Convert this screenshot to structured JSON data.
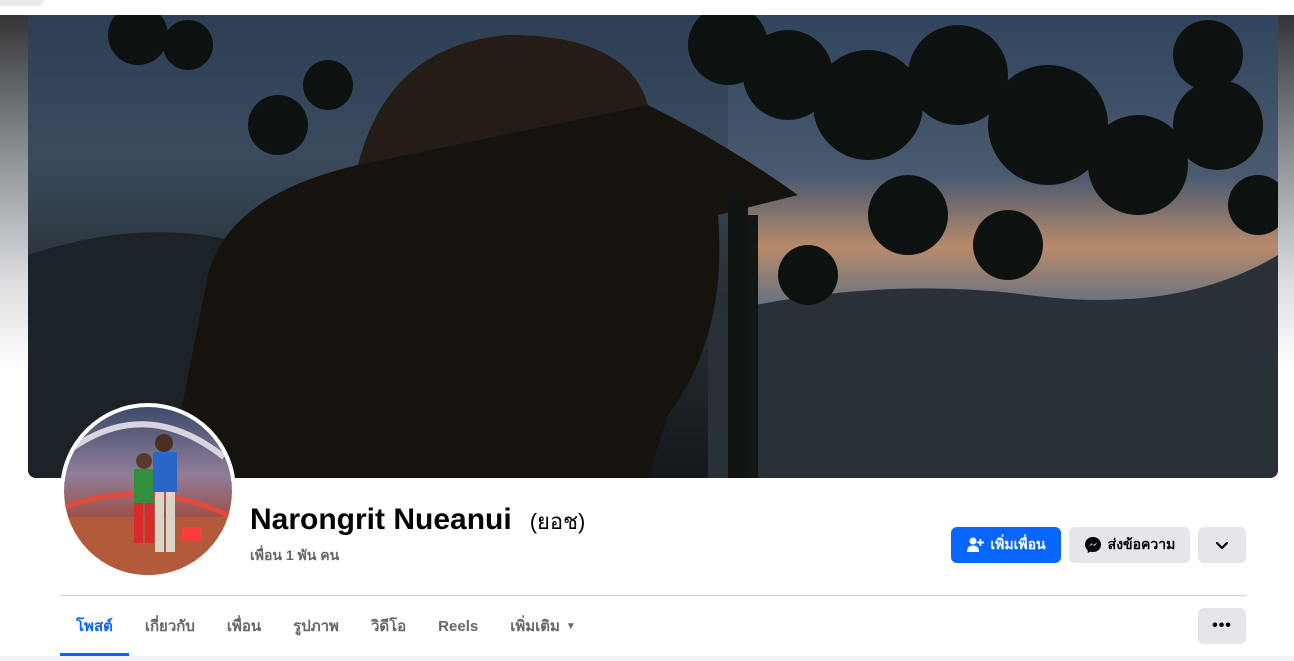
{
  "profile": {
    "name": "Narongrit Nueanui",
    "alternate_name": "(ยอช)",
    "friends_count": "เพื่อน 1 พัน คน"
  },
  "actions": {
    "add_friend": "เพิ่มเพื่อน",
    "message": "ส่งข้อความ",
    "more_icon": "chevron-down-icon"
  },
  "tabs": [
    {
      "label": "โพสต์",
      "active": true
    },
    {
      "label": "เกี่ยวกับ",
      "active": false
    },
    {
      "label": "เพื่อน",
      "active": false
    },
    {
      "label": "รูปภาพ",
      "active": false
    },
    {
      "label": "วิดีโอ",
      "active": false
    },
    {
      "label": "Reels",
      "active": false
    },
    {
      "label": "เพิ่มเติม",
      "active": false
    }
  ],
  "tab_more_label": "•••",
  "colors": {
    "accent": "#0866ff",
    "secondary_button": "#e4e6eb",
    "muted_text": "#65676b"
  }
}
